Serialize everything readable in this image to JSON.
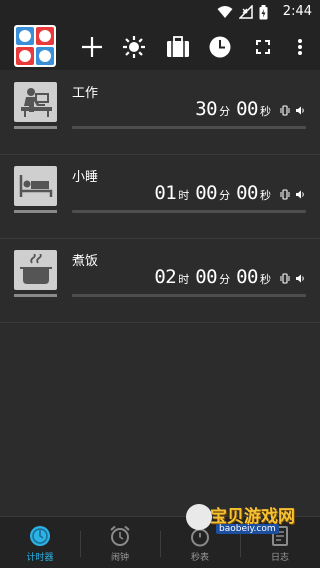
{
  "status_bar": {
    "time": "2:44",
    "icons": [
      "wifi-icon",
      "signal-icon",
      "battery-charging-icon"
    ]
  },
  "toolbar": {
    "logo": "timer-app-logo",
    "buttons": [
      "add-icon",
      "brightness-icon",
      "briefcase-icon",
      "clock-icon",
      "fullscreen-icon",
      "more-vert-icon"
    ]
  },
  "timers": [
    {
      "name": "工作",
      "icon": "desk-work-icon",
      "hours": "",
      "hours_unit": "",
      "minutes": "30",
      "minutes_unit": "分",
      "seconds": "00",
      "seconds_unit": "秒"
    },
    {
      "name": "小睡",
      "icon": "bed-icon",
      "hours": "01",
      "hours_unit": "时",
      "minutes": "00",
      "minutes_unit": "分",
      "seconds": "00",
      "seconds_unit": "秒"
    },
    {
      "name": "煮饭",
      "icon": "cooking-pot-icon",
      "hours": "02",
      "hours_unit": "时",
      "minutes": "00",
      "minutes_unit": "分",
      "seconds": "00",
      "seconds_unit": "秒"
    }
  ],
  "bottom_nav": [
    {
      "label": "计时器",
      "icon": "timer-icon",
      "active": true
    },
    {
      "label": "闹钟",
      "icon": "alarm-icon",
      "active": false
    },
    {
      "label": "秒表",
      "icon": "stopwatch-icon",
      "active": false
    },
    {
      "label": "日志",
      "icon": "log-icon",
      "active": false
    }
  ],
  "watermark": {
    "title": "宝贝游戏网",
    "url": "baobeiy.com"
  },
  "colors": {
    "background": "#2c2c2c",
    "bar": "#232323",
    "accent": "#2bb3e8",
    "logo_quadrants": [
      "#3a8fd8",
      "#e83a3a",
      "#e83a3a",
      "#3a8fd8"
    ]
  }
}
